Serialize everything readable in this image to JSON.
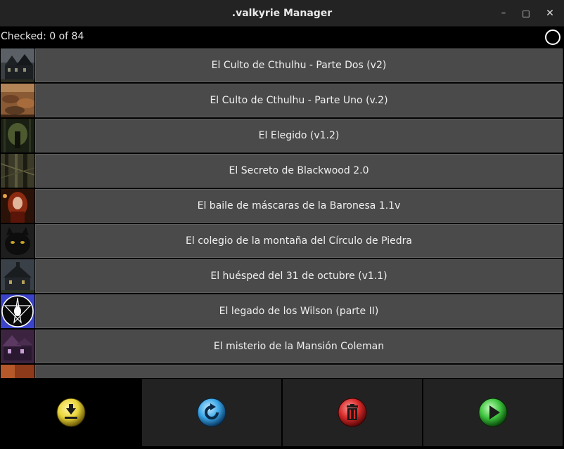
{
  "window": {
    "title": ".valkyrie Manager",
    "minimize_glyph": "–",
    "maximize_glyph": "□",
    "close_glyph": "✕"
  },
  "status": {
    "checked_text": "Checked: 0 of 84"
  },
  "scenarios": [
    {
      "name": "El Culto de Cthulhu - Parte Dos (v2)",
      "thumb": "haunted-mansion"
    },
    {
      "name": "El Culto de Cthulhu - Parte Uno (v.2)",
      "thumb": "rocky-landscape"
    },
    {
      "name": "El Elegido (v1.2)",
      "thumb": "dark-forest"
    },
    {
      "name": "El Secreto de Blackwood 2.0",
      "thumb": "forest-trees"
    },
    {
      "name": "El baile de máscaras de la Baronesa 1.1v",
      "thumb": "red-haired-woman"
    },
    {
      "name": "El colegio de la montaña del Círculo de Piedra",
      "thumb": "black-cat"
    },
    {
      "name": "El huésped del 31 de octubre (v1.1)",
      "thumb": "haunted-house"
    },
    {
      "name": "El legado de los Wilson (parte II)",
      "thumb": "pentagram-goat"
    },
    {
      "name": "El misterio de la Mansión Coleman",
      "thumb": "purple-mansion"
    }
  ],
  "actions": [
    {
      "name": "download",
      "icon": "download-icon",
      "color": "#e8d43a"
    },
    {
      "name": "refresh",
      "icon": "refresh-icon",
      "color": "#3aa7e8"
    },
    {
      "name": "delete",
      "icon": "trash-icon",
      "color": "#d82a2a"
    },
    {
      "name": "play",
      "icon": "play-icon",
      "color": "#3ec43e"
    }
  ]
}
